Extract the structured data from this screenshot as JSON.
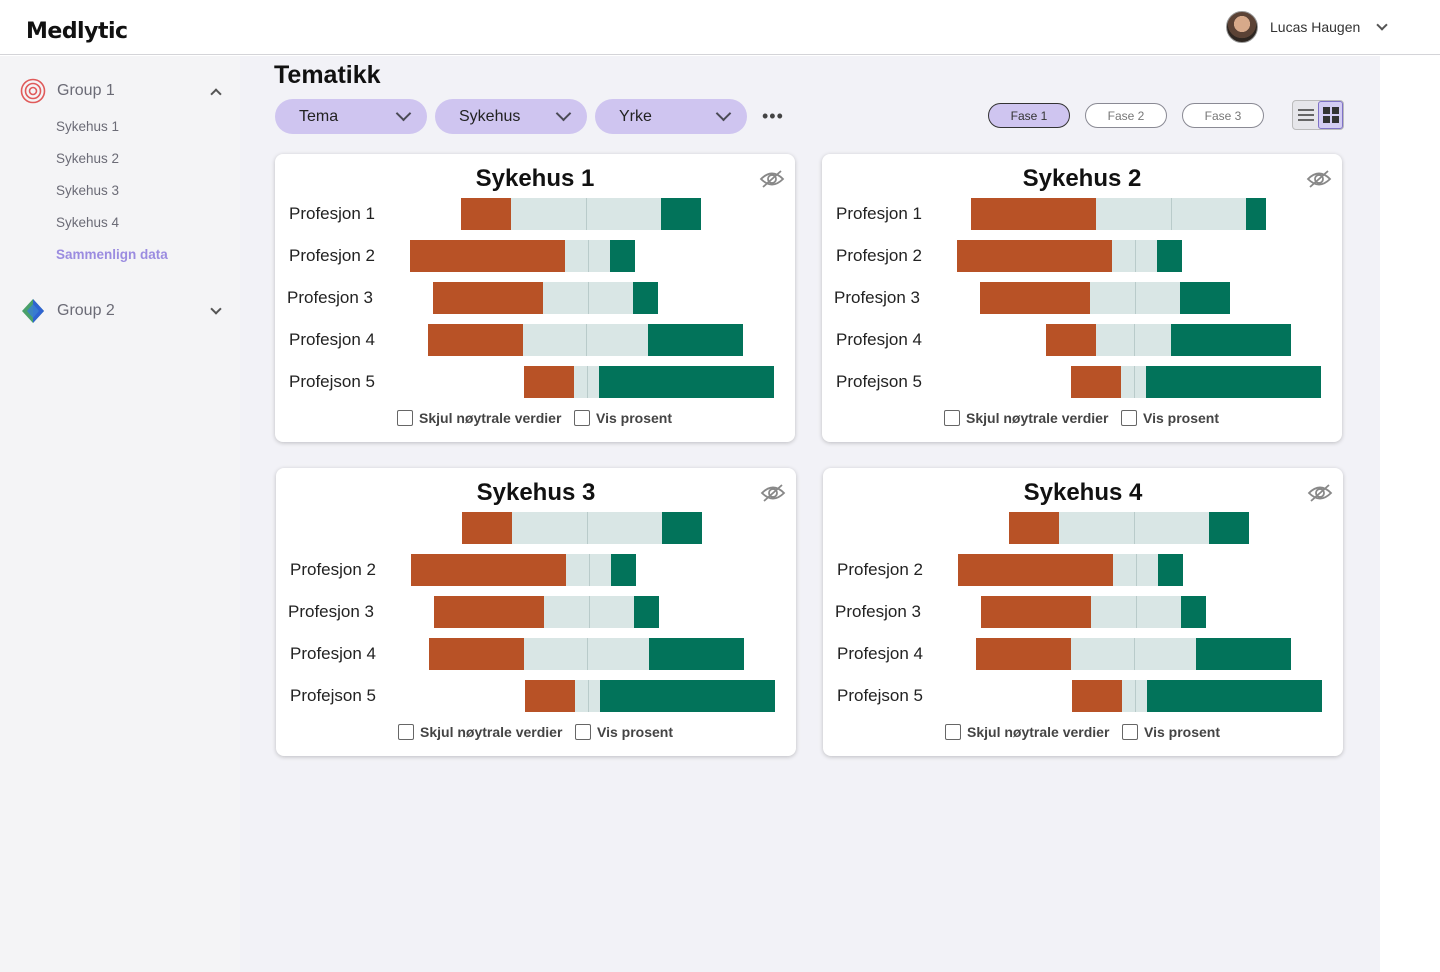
{
  "brand": {
    "logo_text": "Medlytic",
    "accent": "#8e7cc3"
  },
  "user": {
    "name": "Lucas Haugen"
  },
  "sidebar": {
    "groups": [
      {
        "label": "Group 1",
        "expanded": true,
        "items": [
          {
            "label": "Sykehus 1",
            "active": false
          },
          {
            "label": "Sykehus 2",
            "active": false
          },
          {
            "label": "Sykehus 3",
            "active": false
          },
          {
            "label": "Sykehus 4",
            "active": false
          },
          {
            "label": "Sammenlign data",
            "active": true
          }
        ]
      },
      {
        "label": "Group 2",
        "expanded": false,
        "items": []
      }
    ]
  },
  "main": {
    "title": "Tematikk",
    "filters": [
      {
        "label": "Tema"
      },
      {
        "label": "Sykehus"
      },
      {
        "label": "Yrke"
      }
    ],
    "more_label": "•••",
    "phases": [
      {
        "label": "Fase 1",
        "active": true
      },
      {
        "label": "Fase 2",
        "active": false
      },
      {
        "label": "Fase 3",
        "active": false
      }
    ],
    "view_mode": "grid",
    "checkbox_labels": {
      "hide_neutral": "Skjul nøytrale verdier",
      "show_percent": "Vis prosent"
    }
  },
  "colors": {
    "negative": "#b85226",
    "neutral": "#d9e6e5",
    "positive": "#02735a"
  },
  "chart_data": [
    {
      "type": "bar",
      "title": "Sykehus 1",
      "categories": [
        "Profesjon 1",
        "Profesjon 2",
        "Profesjon 3",
        "Profesjon 4",
        "Profejson 5"
      ],
      "series": [
        {
          "values": [
            10,
            31,
            22,
            19,
            10
          ]
        },
        {
          "values": [
            30,
            9,
            18,
            25,
            5
          ]
        },
        {
          "values": [
            8,
            5,
            5,
            19,
            35
          ]
        }
      ]
    },
    {
      "type": "bar",
      "title": "Sykehus 2",
      "categories": [
        "Profesjon 1",
        "Profesjon 2",
        "Profesjon 3",
        "Profesjon 4",
        "Profejson 5"
      ],
      "series": [
        {
          "values": [
            25,
            31,
            22,
            10,
            10
          ]
        },
        {
          "values": [
            30,
            9,
            18,
            15,
            5
          ]
        },
        {
          "values": [
            4,
            5,
            10,
            24,
            35
          ]
        }
      ]
    },
    {
      "type": "bar",
      "title": "Sykehus 3",
      "categories": [
        "",
        "Profesjon 2",
        "Profesjon 3",
        "Profesjon 4",
        "Profejson 5"
      ],
      "series": [
        {
          "values": [
            10,
            31,
            22,
            19,
            10
          ]
        },
        {
          "values": [
            30,
            9,
            18,
            25,
            5
          ]
        },
        {
          "values": [
            8,
            5,
            5,
            19,
            35
          ]
        }
      ]
    },
    {
      "type": "bar",
      "title": "Sykehus 4",
      "categories": [
        "",
        "Profesjon 2",
        "Profesjon 3",
        "Profesjon 4",
        "Profejson 5"
      ],
      "series": [
        {
          "values": [
            10,
            31,
            22,
            19,
            10
          ]
        },
        {
          "values": [
            30,
            9,
            18,
            25,
            5
          ]
        },
        {
          "values": [
            8,
            5,
            5,
            19,
            35
          ]
        }
      ]
    }
  ]
}
